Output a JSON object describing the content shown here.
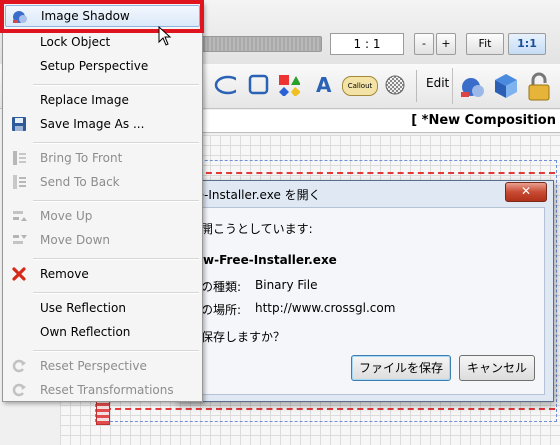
{
  "toolbar": {
    "ratio_value": "1 : 1",
    "zoom_out_label": "-",
    "zoom_in_label": "+",
    "fit_label": "Fit",
    "actual_size_label": "1:1",
    "edit_label": "Edit",
    "tools": [
      "ellipse-tool",
      "rectangle-tool",
      "shapes-tool",
      "text-tool",
      "callout-tool",
      "pattern-tool"
    ],
    "callout_text": "Callout",
    "text_tool_glyph": "A"
  },
  "composition": {
    "title": "[ *New Composition"
  },
  "dialog": {
    "title": "re-Installer.exe を開く",
    "close_label": "✕",
    "prompt": "を開こうとしています:",
    "filename": "raw-Free-Installer.exe",
    "type_label": "ルの種類:",
    "type_value": "Binary File",
    "location_label": "ルの場所:",
    "location_value": "http://www.crossgl.com",
    "question": "を保存しますか？",
    "save_button": "ファイルを保存",
    "cancel_button": "キャンセル"
  },
  "menu": {
    "items": [
      {
        "label": "Image Shadow",
        "icon": "image-shadow-icon",
        "disabled": false,
        "selected": true
      },
      {
        "label": "Lock Object",
        "icon": "",
        "disabled": false
      },
      {
        "label": "Setup Perspective",
        "icon": "",
        "disabled": false
      },
      {
        "label": "Replace Image",
        "icon": "",
        "disabled": false
      },
      {
        "label": "Save Image As ...",
        "icon": "save-icon",
        "disabled": false
      },
      {
        "label": "Bring To Front",
        "icon": "bring-to-front-icon",
        "disabled": true
      },
      {
        "label": "Send To Back",
        "icon": "send-to-back-icon",
        "disabled": true
      },
      {
        "label": "Move Up",
        "icon": "move-up-icon",
        "disabled": true
      },
      {
        "label": "Move Down",
        "icon": "move-down-icon",
        "disabled": true
      },
      {
        "label": "Remove",
        "icon": "remove-icon",
        "disabled": false
      },
      {
        "label": "Use Reflection",
        "icon": "",
        "disabled": false
      },
      {
        "label": "Own Reflection",
        "icon": "",
        "disabled": false
      },
      {
        "label": "Reset Perspective",
        "icon": "reset-perspective-icon",
        "disabled": true
      },
      {
        "label": "Reset Transformations",
        "icon": "reset-transformations-icon",
        "disabled": true
      }
    ]
  },
  "colors": {
    "highlight": "#e0141e",
    "menu_background": "#f5f5f5",
    "disabled_text": "#8d8d8d"
  }
}
